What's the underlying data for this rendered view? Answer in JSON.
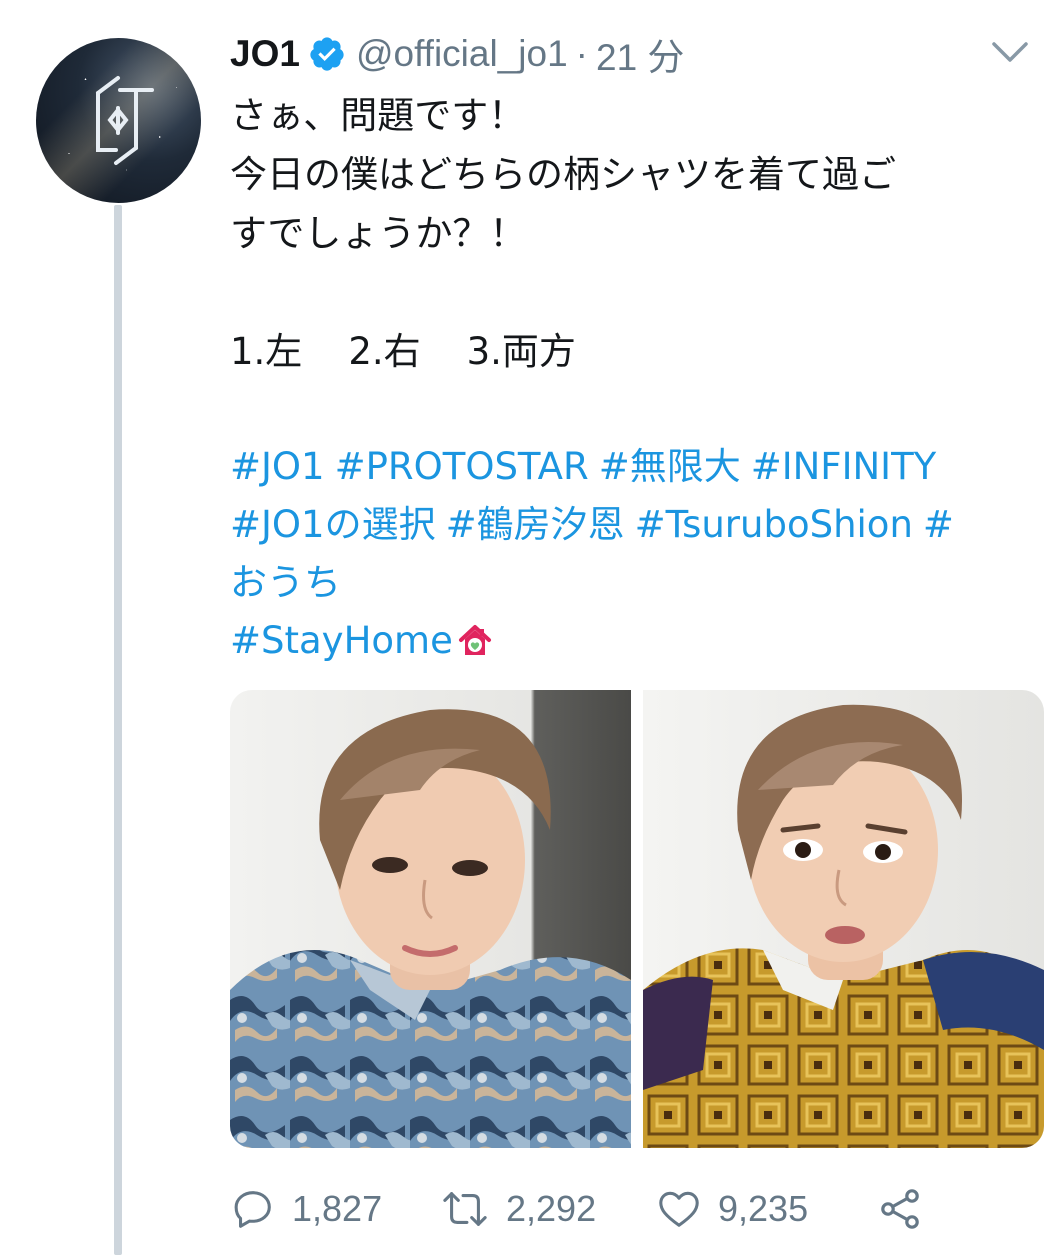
{
  "tweet": {
    "author": {
      "display_name": "JO1",
      "handle": "@official_jo1",
      "separator": "·",
      "time": "21 分",
      "avatar_icon": "jo1-logo-icon"
    },
    "text_lines": [
      "さぁ、問題です！",
      "今日の僕はどちらの柄シャツを着て過ご",
      "すでしょうか？！"
    ],
    "choices": [
      "1.左",
      "2.右",
      "3.両方"
    ],
    "hashtags": {
      "line1": [
        "#JO1",
        "#PROTOSTAR",
        "#無限大",
        "#INFINITY"
      ],
      "line2": [
        "#JO1の選択",
        "#鶴房汐恩",
        "#TsuruboShion",
        "#"
      ],
      "line3": "おうち",
      "line4": "#StayHome"
    },
    "media": [
      {
        "name": "left-photo",
        "shirt": "blue-patterned"
      },
      {
        "name": "right-photo",
        "shirt": "yellow-patterned"
      }
    ],
    "stats": {
      "replies": "1,827",
      "retweets": "2,292",
      "likes": "9,235"
    }
  },
  "colors": {
    "link": "#1b95e0",
    "secondary": "#657786",
    "verified": "#1da1f2",
    "thread_line": "#cdd5dc"
  }
}
